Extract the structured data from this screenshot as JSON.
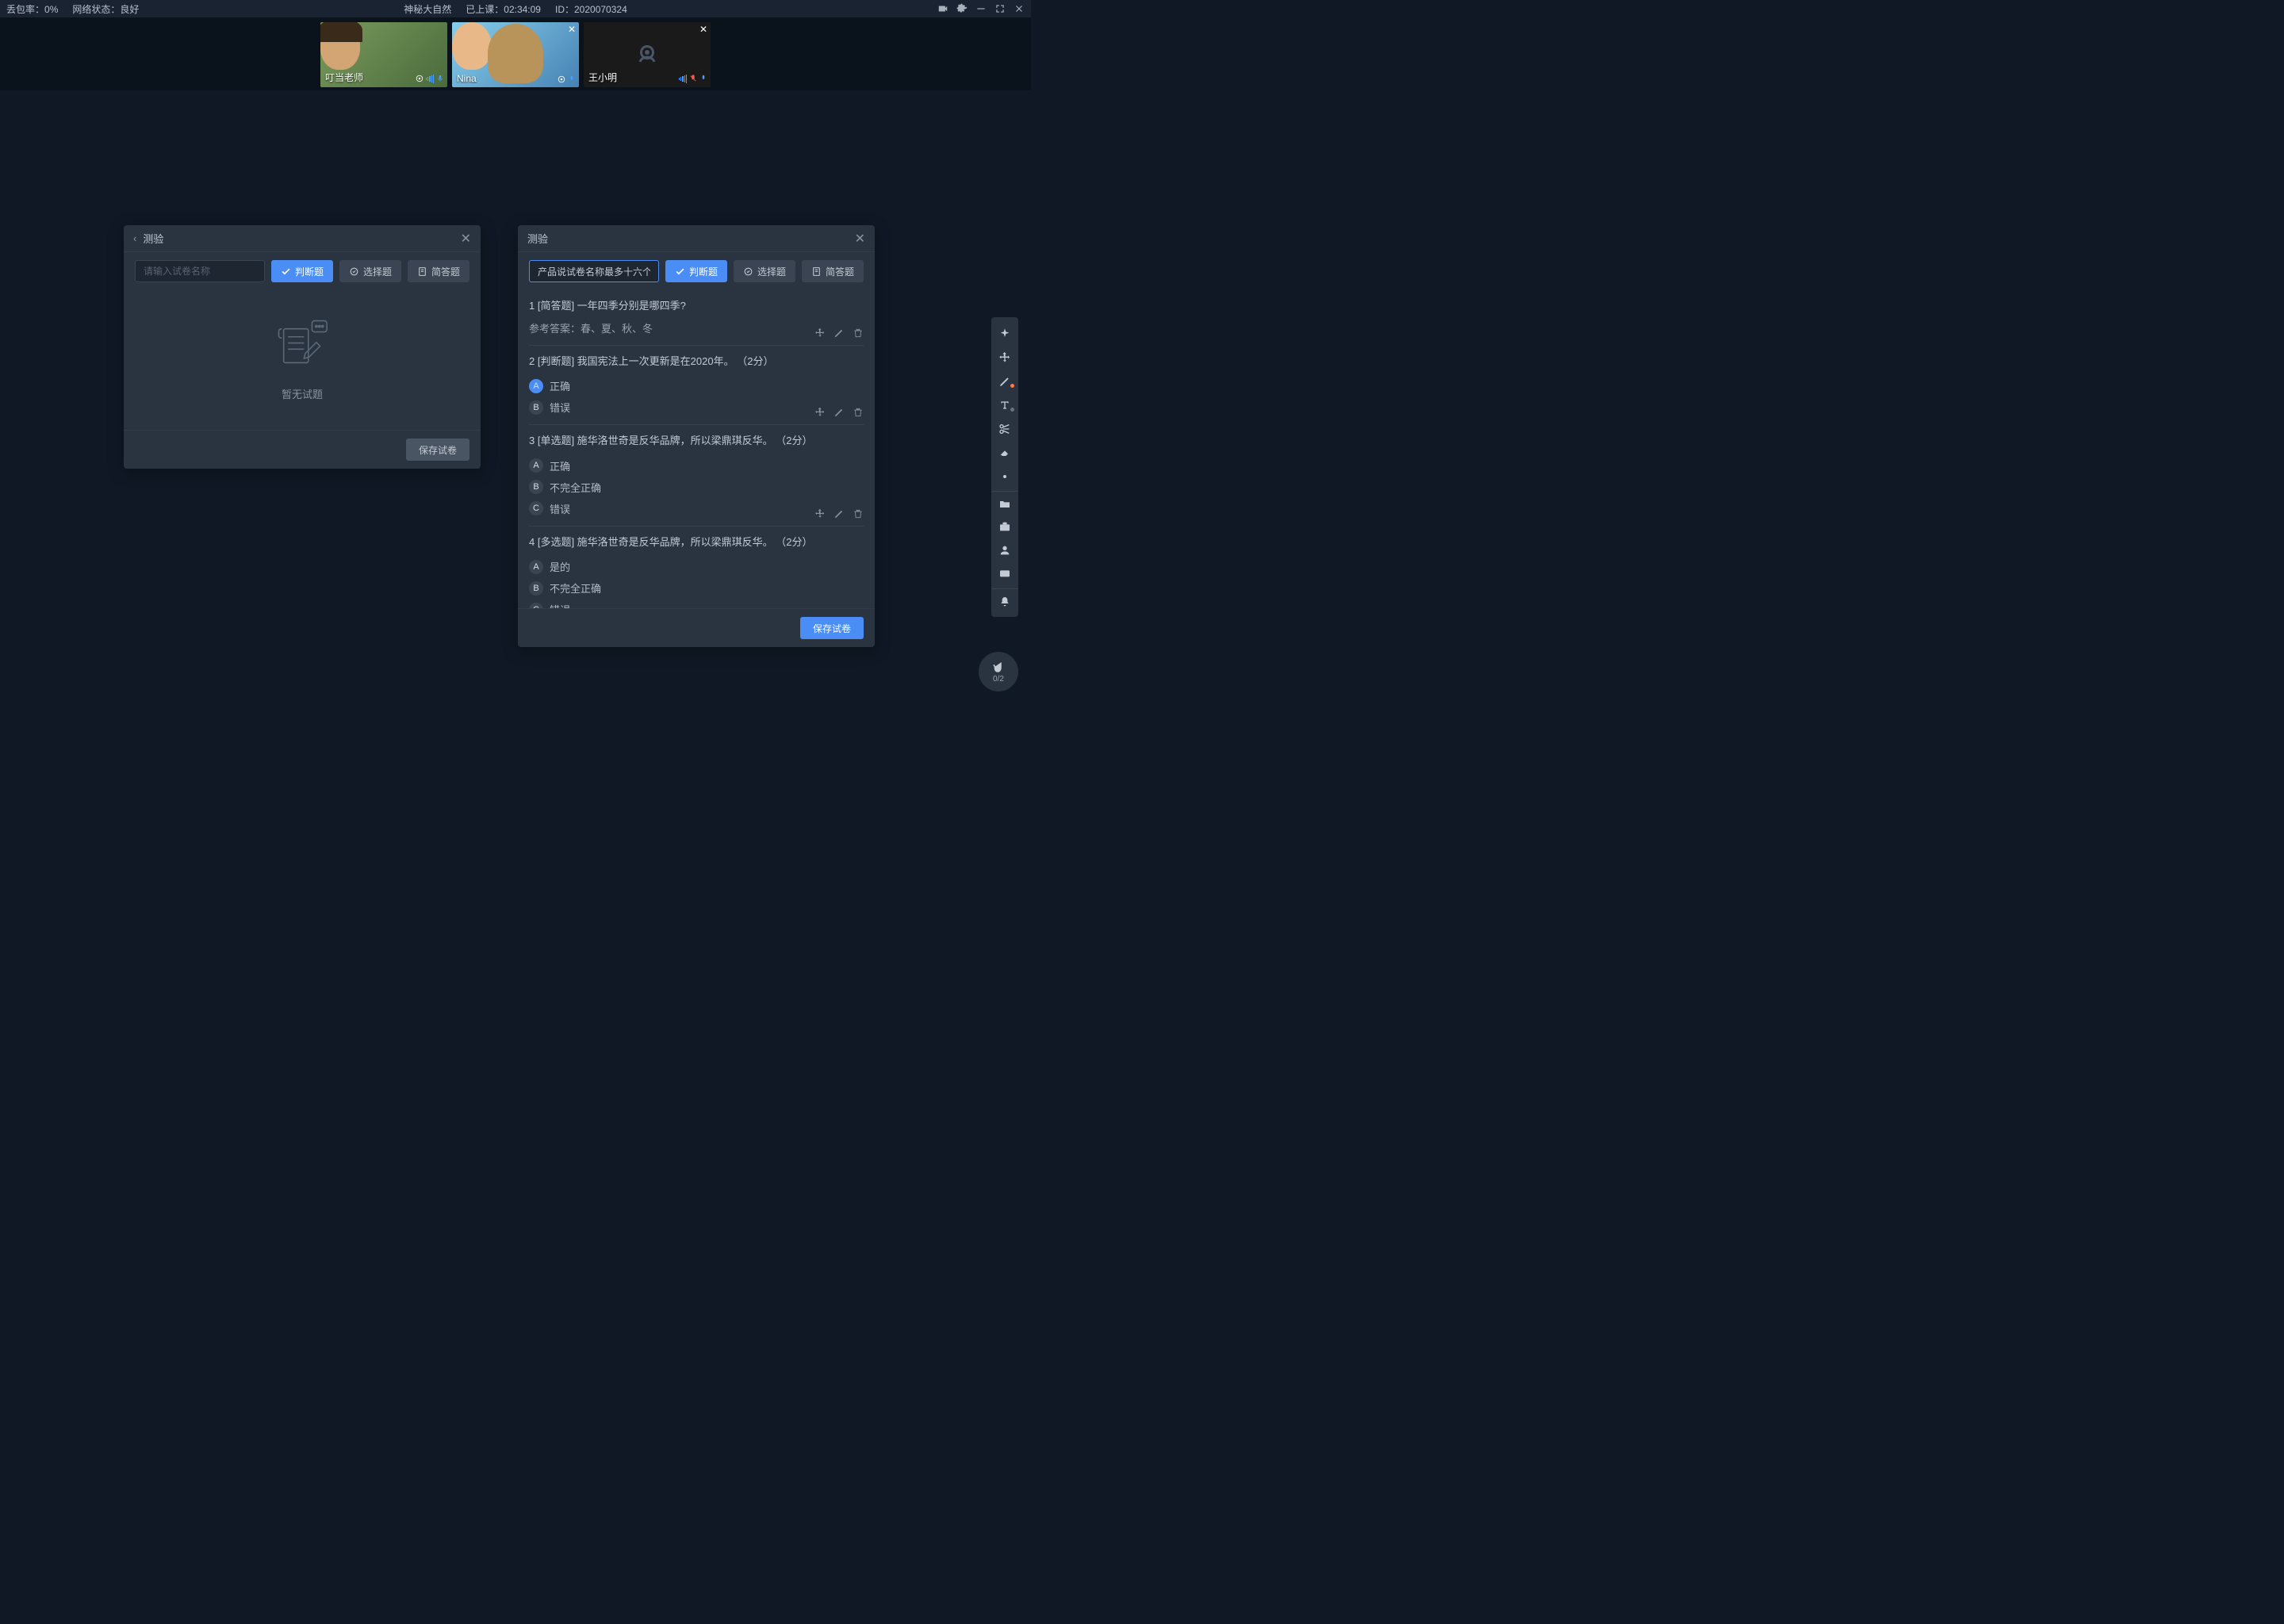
{
  "topbar": {
    "packet_loss_label": "丢包率：",
    "packet_loss_value": "0%",
    "network_label": "网络状态：",
    "network_value": "良好",
    "course_name": "神秘大自然",
    "elapsed_label": "已上课：",
    "elapsed_value": "02:34:09",
    "id_label": "ID：",
    "id_value": "2020070324"
  },
  "videos": [
    {
      "name": "叮当老师",
      "camera_on": true,
      "closeable": false,
      "muted": false
    },
    {
      "name": "Nina",
      "camera_on": true,
      "closeable": true,
      "muted": false
    },
    {
      "name": "王小明",
      "camera_on": false,
      "closeable": true,
      "muted": true
    }
  ],
  "panel_left": {
    "title": "测验",
    "name_placeholder": "请输入试卷名称",
    "type_buttons": {
      "tf": "判断题",
      "choice": "选择题",
      "short": "简答题"
    },
    "empty_text": "暂无试题",
    "save_label": "保存试卷"
  },
  "panel_right": {
    "title": "测验",
    "name_value": "产品说试卷名称最多十六个字",
    "type_buttons": {
      "tf": "判断题",
      "choice": "选择题",
      "short": "简答题"
    },
    "save_label": "保存试卷",
    "answer_prefix": "参考答案：",
    "questions": [
      {
        "idx": "1",
        "type_tag": "[简答题]",
        "text": "一年四季分别是哪四季?",
        "answer_ref": "春、夏、秋、冬",
        "options": []
      },
      {
        "idx": "2",
        "type_tag": "[判断题]",
        "text": "我国宪法上一次更新是在2020年。",
        "points": "（2分）",
        "options": [
          {
            "letter": "A",
            "text": "正确",
            "selected": true
          },
          {
            "letter": "B",
            "text": "错误",
            "selected": false
          }
        ]
      },
      {
        "idx": "3",
        "type_tag": "[单选题]",
        "text": "施华洛世奇是反华品牌，所以梁鼎琪反华。",
        "points": "（2分）",
        "options": [
          {
            "letter": "A",
            "text": "正确",
            "selected": false
          },
          {
            "letter": "B",
            "text": "不完全正确",
            "selected": false
          },
          {
            "letter": "C",
            "text": "错误",
            "selected": false
          }
        ]
      },
      {
        "idx": "4",
        "type_tag": "[多选题]",
        "text": "施华洛世奇是反华品牌，所以梁鼎琪反华。",
        "points": "（2分）",
        "options": [
          {
            "letter": "A",
            "text": "是的",
            "selected": false
          },
          {
            "letter": "B",
            "text": "不完全正确",
            "selected": false
          },
          {
            "letter": "C",
            "text": "错误",
            "selected": false
          }
        ]
      }
    ]
  },
  "hand": {
    "count": "0/2"
  }
}
